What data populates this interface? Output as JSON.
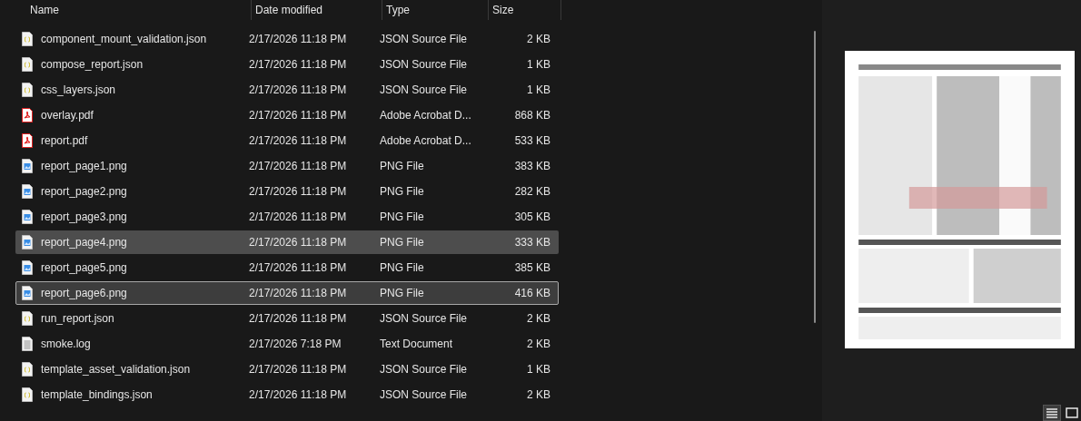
{
  "columns": [
    {
      "label": "Name"
    },
    {
      "label": "Date modified"
    },
    {
      "label": "Type"
    },
    {
      "label": "Size"
    }
  ],
  "files": [
    {
      "name": "component_mount_validation.json",
      "date": "2/17/2026 11:18 PM",
      "type": "JSON Source File",
      "size": "2 KB",
      "kind": "json",
      "selected": false,
      "focused": false
    },
    {
      "name": "compose_report.json",
      "date": "2/17/2026 11:18 PM",
      "type": "JSON Source File",
      "size": "1 KB",
      "kind": "json",
      "selected": false,
      "focused": false
    },
    {
      "name": "css_layers.json",
      "date": "2/17/2026 11:18 PM",
      "type": "JSON Source File",
      "size": "1 KB",
      "kind": "json",
      "selected": false,
      "focused": false
    },
    {
      "name": "overlay.pdf",
      "date": "2/17/2026 11:18 PM",
      "type": "Adobe Acrobat D...",
      "size": "868 KB",
      "kind": "pdf",
      "selected": false,
      "focused": false
    },
    {
      "name": "report.pdf",
      "date": "2/17/2026 11:18 PM",
      "type": "Adobe Acrobat D...",
      "size": "533 KB",
      "kind": "pdf",
      "selected": false,
      "focused": false
    },
    {
      "name": "report_page1.png",
      "date": "2/17/2026 11:18 PM",
      "type": "PNG File",
      "size": "383 KB",
      "kind": "png",
      "selected": false,
      "focused": false
    },
    {
      "name": "report_page2.png",
      "date": "2/17/2026 11:18 PM",
      "type": "PNG File",
      "size": "282 KB",
      "kind": "png",
      "selected": false,
      "focused": false
    },
    {
      "name": "report_page3.png",
      "date": "2/17/2026 11:18 PM",
      "type": "PNG File",
      "size": "305 KB",
      "kind": "png",
      "selected": false,
      "focused": false
    },
    {
      "name": "report_page4.png",
      "date": "2/17/2026 11:18 PM",
      "type": "PNG File",
      "size": "333 KB",
      "kind": "png",
      "selected": true,
      "focused": false
    },
    {
      "name": "report_page5.png",
      "date": "2/17/2026 11:18 PM",
      "type": "PNG File",
      "size": "385 KB",
      "kind": "png",
      "selected": false,
      "focused": false
    },
    {
      "name": "report_page6.png",
      "date": "2/17/2026 11:18 PM",
      "type": "PNG File",
      "size": "416 KB",
      "kind": "png",
      "selected": true,
      "focused": true
    },
    {
      "name": "run_report.json",
      "date": "2/17/2026 11:18 PM",
      "type": "JSON Source File",
      "size": "2 KB",
      "kind": "json",
      "selected": false,
      "focused": false
    },
    {
      "name": "smoke.log",
      "date": "2/17/2026 7:18 PM",
      "type": "Text Document",
      "size": "2 KB",
      "kind": "txt",
      "selected": false,
      "focused": false
    },
    {
      "name": "template_asset_validation.json",
      "date": "2/17/2026 11:18 PM",
      "type": "JSON Source File",
      "size": "1 KB",
      "kind": "json",
      "selected": false,
      "focused": false
    },
    {
      "name": "template_bindings.json",
      "date": "2/17/2026 11:18 PM",
      "type": "JSON Source File",
      "size": "2 KB",
      "kind": "json",
      "selected": false,
      "focused": false
    }
  ],
  "view_buttons": [
    {
      "kind": "details",
      "selected": true
    },
    {
      "kind": "large-icons",
      "selected": false
    }
  ]
}
